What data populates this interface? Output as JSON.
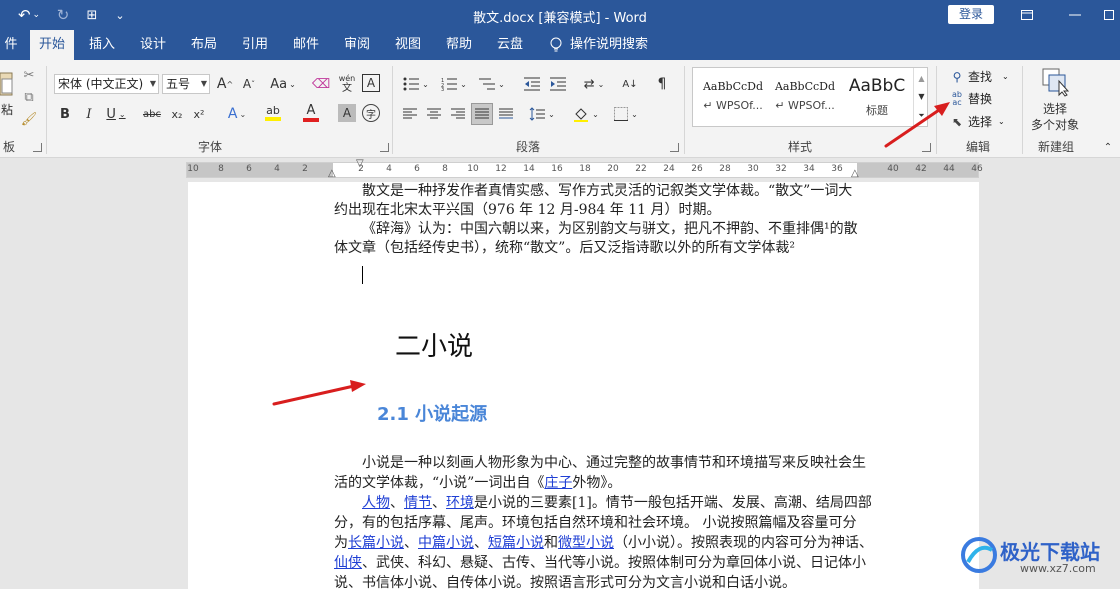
{
  "window": {
    "title": "散文.docx [兼容模式]  -  Word",
    "login_label": "登录"
  },
  "tabs": [
    "件",
    "开始",
    "插入",
    "设计",
    "布局",
    "引用",
    "邮件",
    "审阅",
    "视图",
    "帮助",
    "云盘"
  ],
  "active_tab": "开始",
  "tell_me": "操作说明搜索",
  "ribbon": {
    "clipboard": {
      "paste_label": "粘",
      "group_label": "板"
    },
    "font": {
      "font_name": "宋体 (中文正文)",
      "font_size": "五号",
      "group_label": "字体",
      "grow": "A",
      "shrink": "A",
      "case": "Aa",
      "phonetic": "wén",
      "border_char": "A",
      "bold": "B",
      "italic": "I",
      "underline": "U",
      "strike": "abc",
      "subscript": "x₂",
      "superscript": "x²",
      "effects": "A",
      "highlight": "ab",
      "font_color": "A",
      "shade": "A",
      "enclose": "字"
    },
    "paragraph": {
      "group_label": "段落"
    },
    "styles": {
      "group_label": "样式",
      "items": [
        {
          "sample": "AaBbCcDd",
          "name": "↵ WPSOf..."
        },
        {
          "sample": "AaBbCcDd",
          "name": "↵ WPSOf..."
        },
        {
          "sample": "AaBbC",
          "name": "标题"
        }
      ]
    },
    "editing": {
      "group_label": "编辑",
      "find": "查找",
      "replace": "替换",
      "select": "选择"
    },
    "newgroup": {
      "group_label": "新建组",
      "line1": "选择",
      "line2": "多个对象"
    }
  },
  "ruler": [
    "10",
    "8",
    "6",
    "4",
    "2",
    "",
    "2",
    "4",
    "6",
    "8",
    "10",
    "12",
    "14",
    "16",
    "18",
    "20",
    "22",
    "24",
    "26",
    "28",
    "30",
    "32",
    "34",
    "36",
    "",
    "40",
    "42",
    "44",
    "46"
  ],
  "document": {
    "p0_l1": "散文是一种抒发作者真情实感、写作方式灵活的记叙类文学体裁。“散文”一词大",
    "p0_l2": "约出现在北宋太平兴国（976 年 12 月-984 年 11 月）时期。",
    "p1_l1": "《辞海》认为：中国六朝以来，为区别韵文与骈文，把凡不押韵、不重排偶¹的散",
    "p1_l2": "体文章（包括经传史书），统称“散文”。后又泛指诗歌以外的所有文学体裁²",
    "heading1": "二小说",
    "heading2": "2.1 小说起源",
    "p2_l1": "小说是一种以刻画人物形象为中心、通过完整的故事情节和环境描写来反映社会生",
    "p2_l2a": "活的文学体裁，“小说”一词出自《",
    "p2_l2_link": "庄子",
    "p2_l2b": "外物》。",
    "p3_l1_link1": "人物",
    "p3_l1_sep1": "、",
    "p3_l1_link2": "情节",
    "p3_l1_sep2": "、",
    "p3_l1_link3": "环境",
    "p3_l1_rest": "是小说的三要素[1]。情节一般包括开端、发展、高潮、结局四部",
    "p3_l2": "分，有的包括序幕、尾声。环境包括自然环境和社会环境。 小说按照篇幅及容量可分",
    "p3_l3_pre": "为",
    "p3_l3_link1": "长篇小说",
    "p3_l3_sep1": "、",
    "p3_l3_link2": "中篇小说",
    "p3_l3_sep2": "、",
    "p3_l3_link3": "短篇小说",
    "p3_l3_mid": "和",
    "p3_l3_link4": "微型小说",
    "p3_l3_rest": "（小小说）。按照表现的内容可分为神话、",
    "p3_l4_link": "仙侠",
    "p3_l4_rest": "、武侠、科幻、悬疑、古传、当代等小说。按照体制可分为章回体小说、日记体小",
    "p3_l5": "说、书信体小说、自传体小说。按照语言形式可分为文言小说和白话小说。"
  },
  "watermark": {
    "name": "极光下载站",
    "url": "www.xz7.com"
  },
  "colors": {
    "word_blue": "#2b579a",
    "heading2": "#4a86d8",
    "link": "#1f3fd4",
    "arrow": "#d81e1e"
  }
}
